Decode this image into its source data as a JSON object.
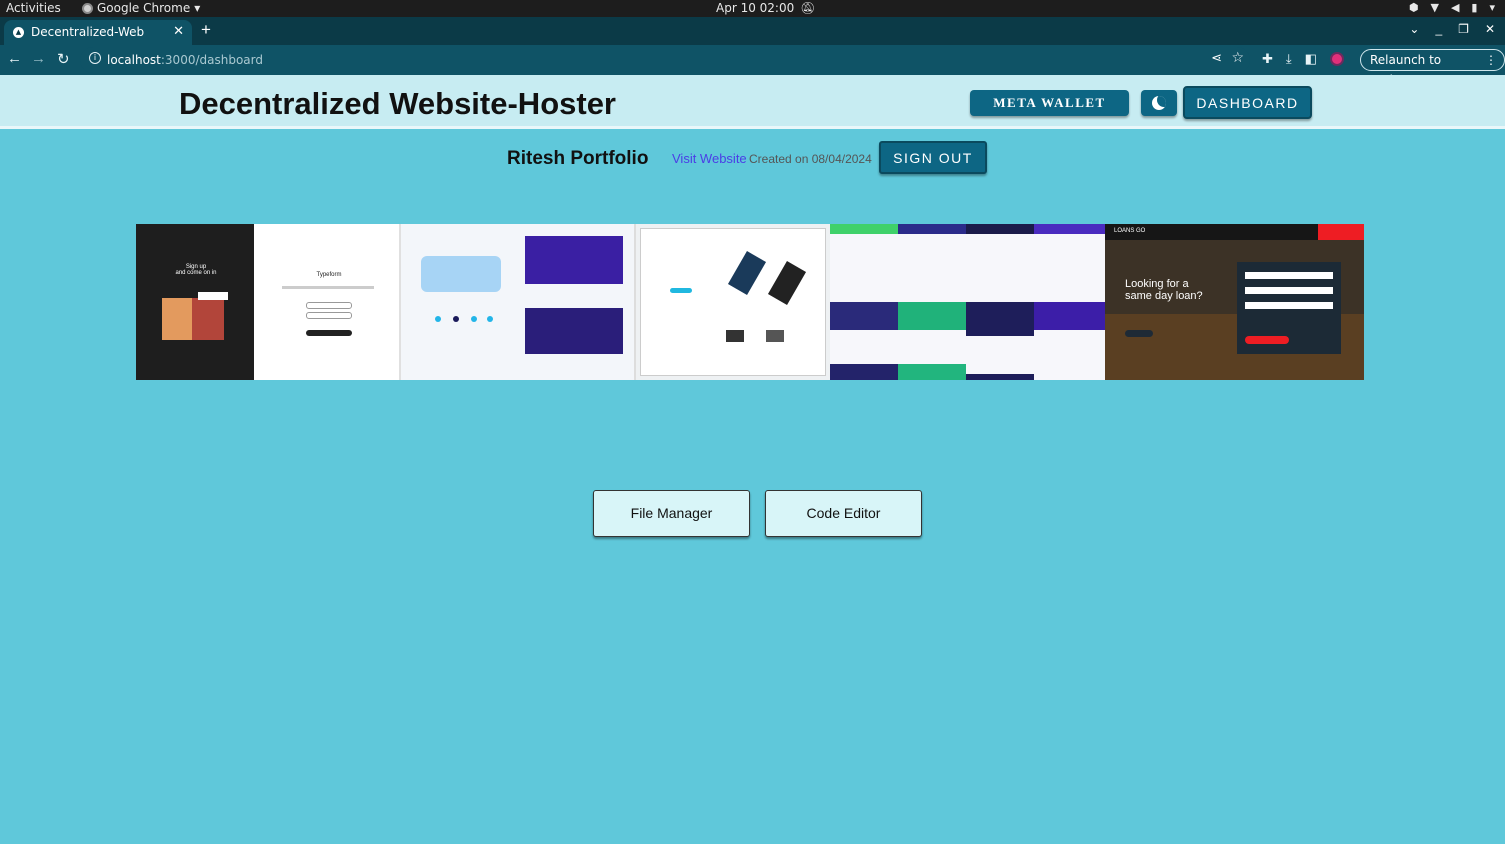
{
  "system_bar": {
    "activities": "Activities",
    "app_name": "Google Chrome",
    "clock": "Apr 10  02:00"
  },
  "browser": {
    "tab_title": "Decentralized-Web",
    "url_host": "localhost",
    "url_path": ":3000/dashboard",
    "relaunch_label": "Relaunch to update"
  },
  "header": {
    "title": "Decentralized Website-Hoster",
    "meta_wallet_label": "META WALLET",
    "dashboard_label": "DASHBOARD"
  },
  "site_info": {
    "name": "Ritesh Portfolio",
    "visit_label": "Visit Website",
    "created_label": "Created on 08/04/2024",
    "sign_out_label": "SIGN OUT"
  },
  "thumbnails": {
    "signup_text": "Sign up\nand come on in",
    "typeform_text": "Typeform",
    "loan_heading": "Looking for a\nsame day loan?",
    "loan_logo": "LOANS GO"
  },
  "actions": {
    "file_manager_label": "File Manager",
    "code_editor_label": "Code Editor"
  },
  "colors": {
    "page_background": "#5fc8da",
    "header_background": "#c7ecf2",
    "primary_button": "#0d6684",
    "browser_chrome": "#0f5366",
    "link": "#4b3ee6"
  }
}
